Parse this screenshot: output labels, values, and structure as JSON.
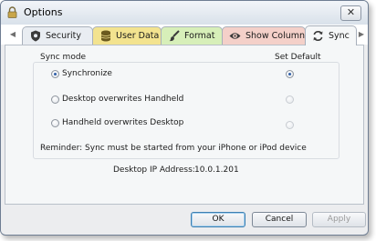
{
  "window": {
    "title": "Options",
    "close_glyph": "✕"
  },
  "tabs": [
    {
      "label": "Security",
      "icon": "shield-icon",
      "color": "#e9edf2"
    },
    {
      "label": "User Data",
      "icon": "database-icon",
      "color": "#f3e38f"
    },
    {
      "label": "Format",
      "icon": "brush-icon",
      "color": "#d7efb9"
    },
    {
      "label": "Show Column",
      "icon": "eye-icon",
      "color": "#f4d0c9"
    },
    {
      "label": "Sync",
      "icon": "sync-icon",
      "color": "#e3e6f7",
      "selected": true
    }
  ],
  "sync": {
    "mode_header": "Sync mode",
    "default_header": "Set Default",
    "options": [
      {
        "label": "Synchronize",
        "checked": true,
        "default_checked": true
      },
      {
        "label": "Desktop overwrites Handheld",
        "checked": false,
        "default_checked": false
      },
      {
        "label": "Handheld overwrites Desktop",
        "checked": false,
        "default_checked": false
      }
    ],
    "reminder": "Reminder: Sync must be started from your iPhone or iPod device"
  },
  "ip": {
    "label": "Desktop IP Address:",
    "value": "10.0.1.201"
  },
  "buttons": {
    "ok": "OK",
    "cancel": "Cancel",
    "apply": "Apply"
  }
}
